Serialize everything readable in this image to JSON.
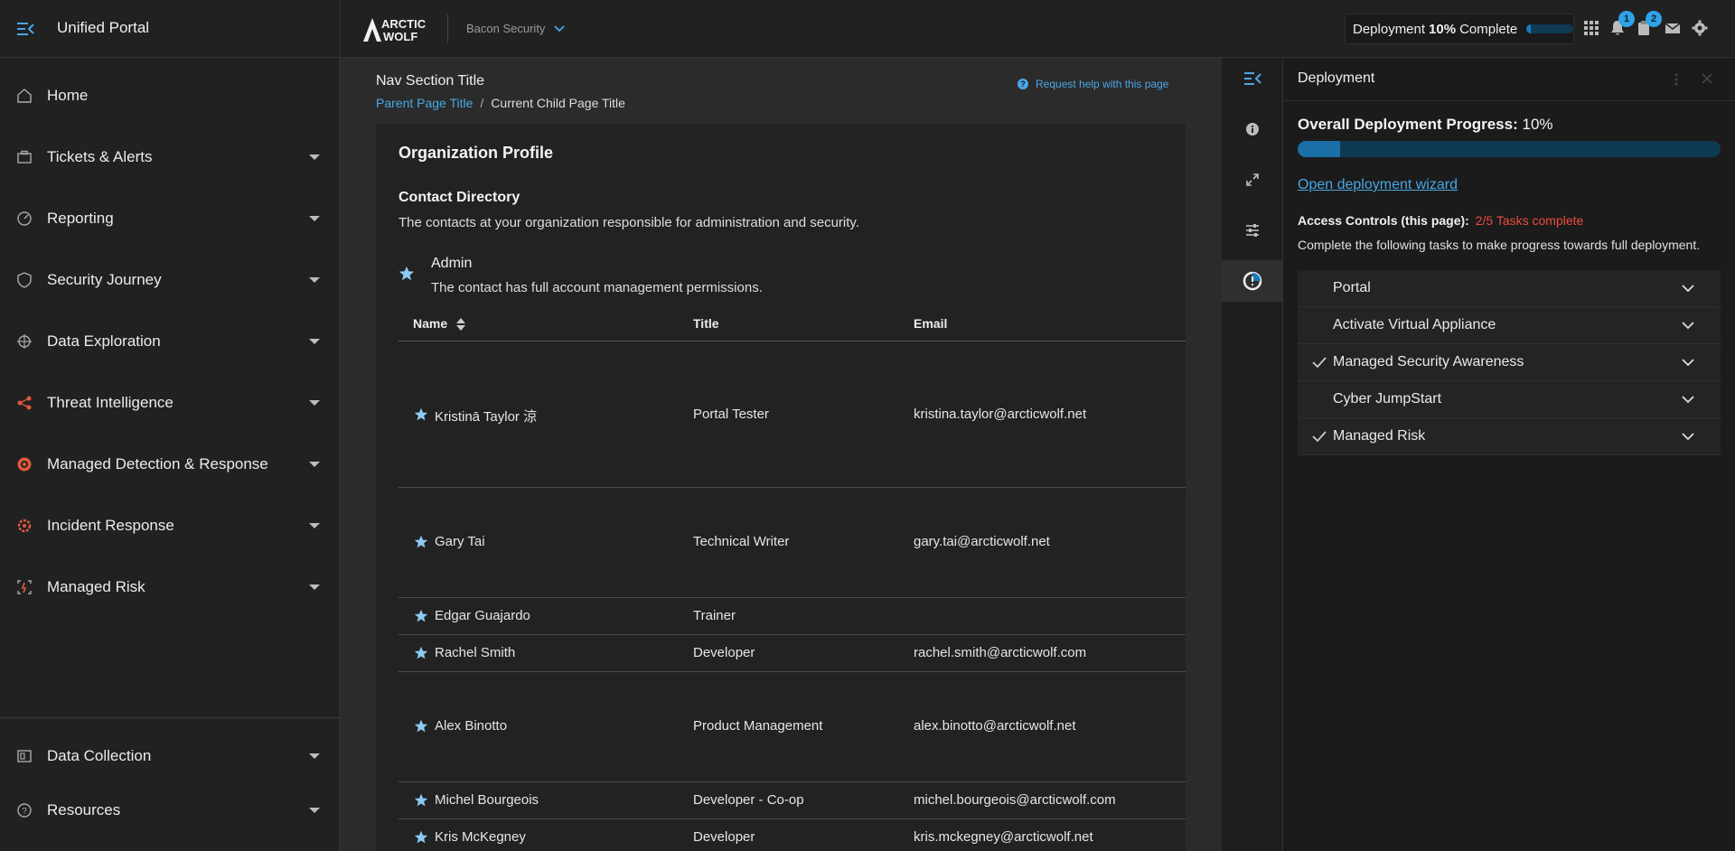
{
  "header": {
    "app_title": "Unified Portal",
    "org_name": "Bacon Security",
    "logo_text_top": "ARCTIC",
    "logo_text_bottom": "WOLF",
    "deployment_prefix": "Deployment",
    "deployment_percent": "10%",
    "deployment_suffix": "Complete",
    "deployment_progress_fraction": 0.1,
    "notification_count": "1",
    "tasks_count": "2",
    "icons": [
      "menu-collapse-icon",
      "apps-grid-icon",
      "bell-icon",
      "clipboard-icon",
      "mail-icon",
      "gear-icon"
    ]
  },
  "sidebar": {
    "items": [
      {
        "label": "Home",
        "icon": "home-icon",
        "has_caret": false
      },
      {
        "label": "Tickets & Alerts",
        "icon": "briefcase-icon",
        "has_caret": true
      },
      {
        "label": "Reporting",
        "icon": "gauge-icon",
        "has_caret": true
      },
      {
        "label": "Security Journey",
        "icon": "shield-icon",
        "has_caret": true
      },
      {
        "label": "Data Exploration",
        "icon": "crosshair-icon",
        "has_caret": true
      },
      {
        "label": "Threat Intelligence",
        "icon": "network-icon",
        "has_caret": true
      },
      {
        "label": "Managed Detection & Response",
        "icon": "radar-icon",
        "has_caret": true
      },
      {
        "label": "Incident Response",
        "icon": "cog-alert-icon",
        "has_caret": true
      },
      {
        "label": "Managed Risk",
        "icon": "risk-icon",
        "has_caret": true
      }
    ],
    "bottom_items": [
      {
        "label": "Data Collection",
        "icon": "collector-icon",
        "has_caret": true
      },
      {
        "label": "Resources",
        "icon": "help-circle-icon",
        "has_caret": true
      }
    ]
  },
  "main": {
    "nav_section_title": "Nav Section Title",
    "breadcrumb": {
      "parent": "Parent Page Title",
      "separator": "/",
      "current": "Current Child Page Title"
    },
    "help_link": "Request help with this page",
    "help_icon_char": "?",
    "card": {
      "title": "Organization Profile",
      "directory_title": "Contact Directory",
      "directory_desc": "The contacts at your organization responsible for administration and security.",
      "legend_title": "Admin",
      "legend_desc": "The contact has full account management permissions.",
      "columns": {
        "name": "Name",
        "title": "Title",
        "email": "Email"
      },
      "rows": [
        {
          "name": "Kristinā Taylor 涼",
          "title": "Portal Tester",
          "email": "kristina.taylor@arcticwolf.net"
        },
        {
          "name": "Gary Tai",
          "title": "Technical Writer",
          "email": "gary.tai@arcticwolf.net"
        },
        {
          "name": "Edgar Guajardo",
          "title": "Trainer",
          "email": ""
        },
        {
          "name": "Rachel Smith",
          "title": "Developer",
          "email": "rachel.smith@arcticwolf.com"
        },
        {
          "name": "Alex Binotto",
          "title": "Product Management",
          "email": "alex.binotto@arcticwolf.net"
        },
        {
          "name": "Michel Bourgeois",
          "title": "Developer - Co-op",
          "email": "michel.bourgeois@arcticwolf.com"
        },
        {
          "name": "Kris McKegney",
          "title": "Developer",
          "email": "kris.mckegney@arcticwolf.net"
        }
      ]
    }
  },
  "rail": {
    "icons": [
      "panel-collapse-icon",
      "info-icon",
      "expand-icon",
      "sliders-icon",
      "deployment-progress-icon"
    ]
  },
  "panel": {
    "title": "Deployment",
    "progress_label": "Overall Deployment Progress:",
    "progress_value": "10%",
    "progress_fraction": 0.1,
    "wizard_link": "Open deployment wizard",
    "access_label": "Access Controls (this page):",
    "access_tasks": "2/5 Tasks complete",
    "access_desc": "Complete the following tasks to make progress towards full deployment.",
    "tasks": [
      {
        "label": "Portal",
        "complete": false
      },
      {
        "label": "Activate Virtual Appliance",
        "complete": false
      },
      {
        "label": "Managed Security Awareness",
        "complete": true
      },
      {
        "label": "Cyber JumpStart",
        "complete": false
      },
      {
        "label": "Managed Risk",
        "complete": true
      }
    ]
  },
  "colors": {
    "accent": "#49a7e6",
    "badge": "#2ea3e8",
    "danger": "#ea4d3d",
    "star": "#8ccaf2",
    "progress_fill": "#1a6fa6",
    "progress_track": "#0d3a52",
    "orange_icon": "#e0583c"
  }
}
